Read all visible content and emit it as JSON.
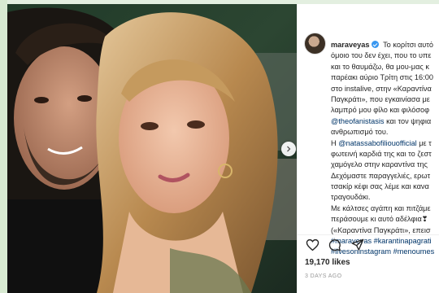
{
  "post": {
    "username": "maraveyas",
    "caption_lines": [
      "Το κορίτσι αυτό",
      "όμοιο του δεν έχει, που το υπε",
      "και το θαυμάζω, θα μου-μας κ",
      "παρέακι αύριο Τρίτη στις 16:00",
      "στο instalive, στην «Καραντίνα",
      "Παγκράτι», που εγκαινίασα με",
      "λαμπρό μου φίλο και φιλόσοφ",
      "@theofanistasis και τον ψηφια",
      "ανθρωπισμό του.",
      "Η @natassabofiliouofficial με τ",
      "φωτεινή καρδιά της και το ζεστ",
      "χαμόγελο στην καραντίνα της",
      "Δεχόμαστε παραγγελιές, ερωτ",
      "τσακίρ κέφι σας λέμε και κανα",
      "τραγουδάκι.",
      "Με κάλτσες αγάπη και πιτζάμε",
      "περάσουμε κι αυτό αδέλφια❣",
      "(«Καραντίνα Παγκράτι», επεισ",
      "#maraveyas #karantinapagrati",
      "#livesoninstagram #menoumes"
    ],
    "mention_1": "@theofanistasis",
    "mention_1_rest": " και τον ψηφια",
    "mention_2_pre": "Η ",
    "mention_2": "@natassabofiliouofficial",
    "mention_2_rest": " με τ",
    "hashtags_line_1": "#maraveyas #karantinapagrati",
    "hashtags_line_2": "#livesoninstagram #menoumes",
    "likes": "19,170 likes",
    "time_ago": "3 DAYS AGO"
  },
  "colors": {
    "link": "#003569",
    "verified": "#3897f0",
    "frame_green": "#d8ead2"
  },
  "icons": [
    "heart-icon",
    "comment-icon",
    "share-icon",
    "chevron-right-icon",
    "verified-badge-icon"
  ]
}
